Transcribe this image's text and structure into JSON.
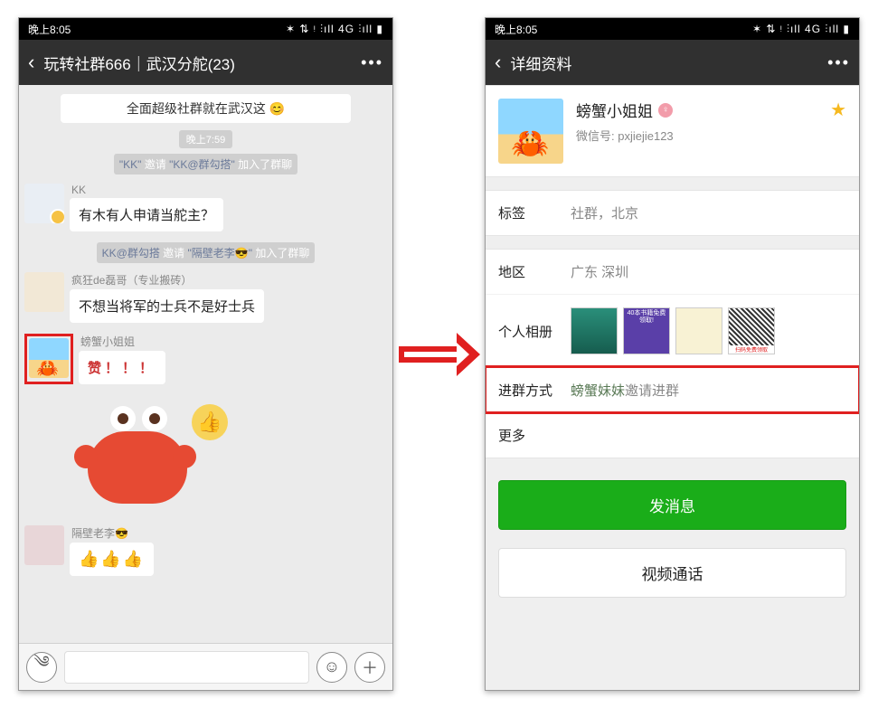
{
  "statusbar": {
    "time": "晚上8:05",
    "indicators": "✶ ⇅ ᵎ ⫶ıll 4G ⫶ıll ▮"
  },
  "chat": {
    "title": "玩转社群666｜武汉分舵(23)",
    "cut_msg_text": "全面超级社群就在武汉这 😊",
    "time_pill": "晚上7:59",
    "sys_invite_1_prefix": "\"KK\"",
    "sys_invite_1_mid": "邀请",
    "sys_invite_1_name": "\"KK@群勾搭\"",
    "sys_invite_1_suffix": "加入了群聊",
    "msg1_sender": "KK",
    "msg1_text": "有木有人申请当舵主？",
    "sys_invite_2_prefix": "KK@群勾搭",
    "sys_invite_2_mid": "邀请",
    "sys_invite_2_name": "\"隔壁老李😎\"",
    "sys_invite_2_suffix": "加入了群聊",
    "msg2_sender": "疯狂de磊哥（专业搬砖）",
    "msg2_text": "不想当将军的士兵不是好士兵",
    "msg3_sender": "螃蟹小姐姐",
    "msg3_text": "赞！！！",
    "msg4_sender": "隔壁老李😎",
    "msg4_text": "👍👍👍"
  },
  "profile": {
    "title": "详细资料",
    "nickname": "螃蟹小姐姐",
    "wxid_label": "微信号: ",
    "wxid": "pxjiejie123",
    "tags_label": "标签",
    "tags_value": "社群，北京",
    "region_label": "地区",
    "region_value": "广东  深圳",
    "album_label": "个人相册",
    "album_banner": "40本书籍免费领取!",
    "qr_caption": "扫码免费领取",
    "join_label": "进群方式",
    "join_inviter": "螃蟹妹妹",
    "join_suffix": "邀请进群",
    "more_label": "更多",
    "send_btn": "发消息",
    "video_btn": "视频通话"
  }
}
